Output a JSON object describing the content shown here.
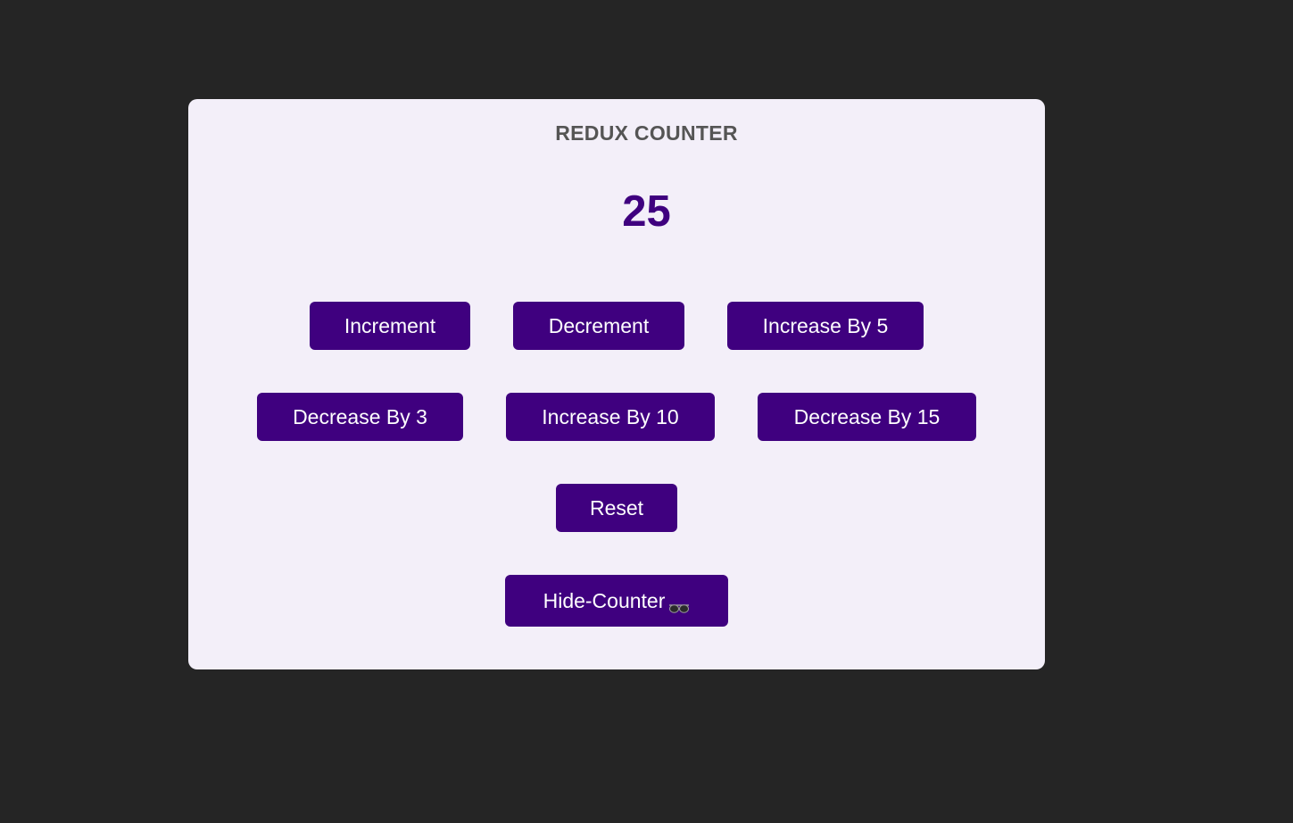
{
  "app": {
    "title": "REDUX COUNTER"
  },
  "counter": {
    "value": "25"
  },
  "buttons": {
    "increment": "Increment",
    "decrement": "Decrement",
    "increase_by_5": "Increase By 5",
    "decrease_by_3": "Decrease By 3",
    "increase_by_10": "Increase By 10",
    "decrease_by_15": "Decrease By 15",
    "reset": "Reset",
    "hide_counter": "Hide-Counter",
    "hide_counter_icon": "sunglasses-icon"
  },
  "colors": {
    "background": "#252525",
    "card": "#f3eff9",
    "accent": "#3f007f",
    "title": "#555555"
  }
}
